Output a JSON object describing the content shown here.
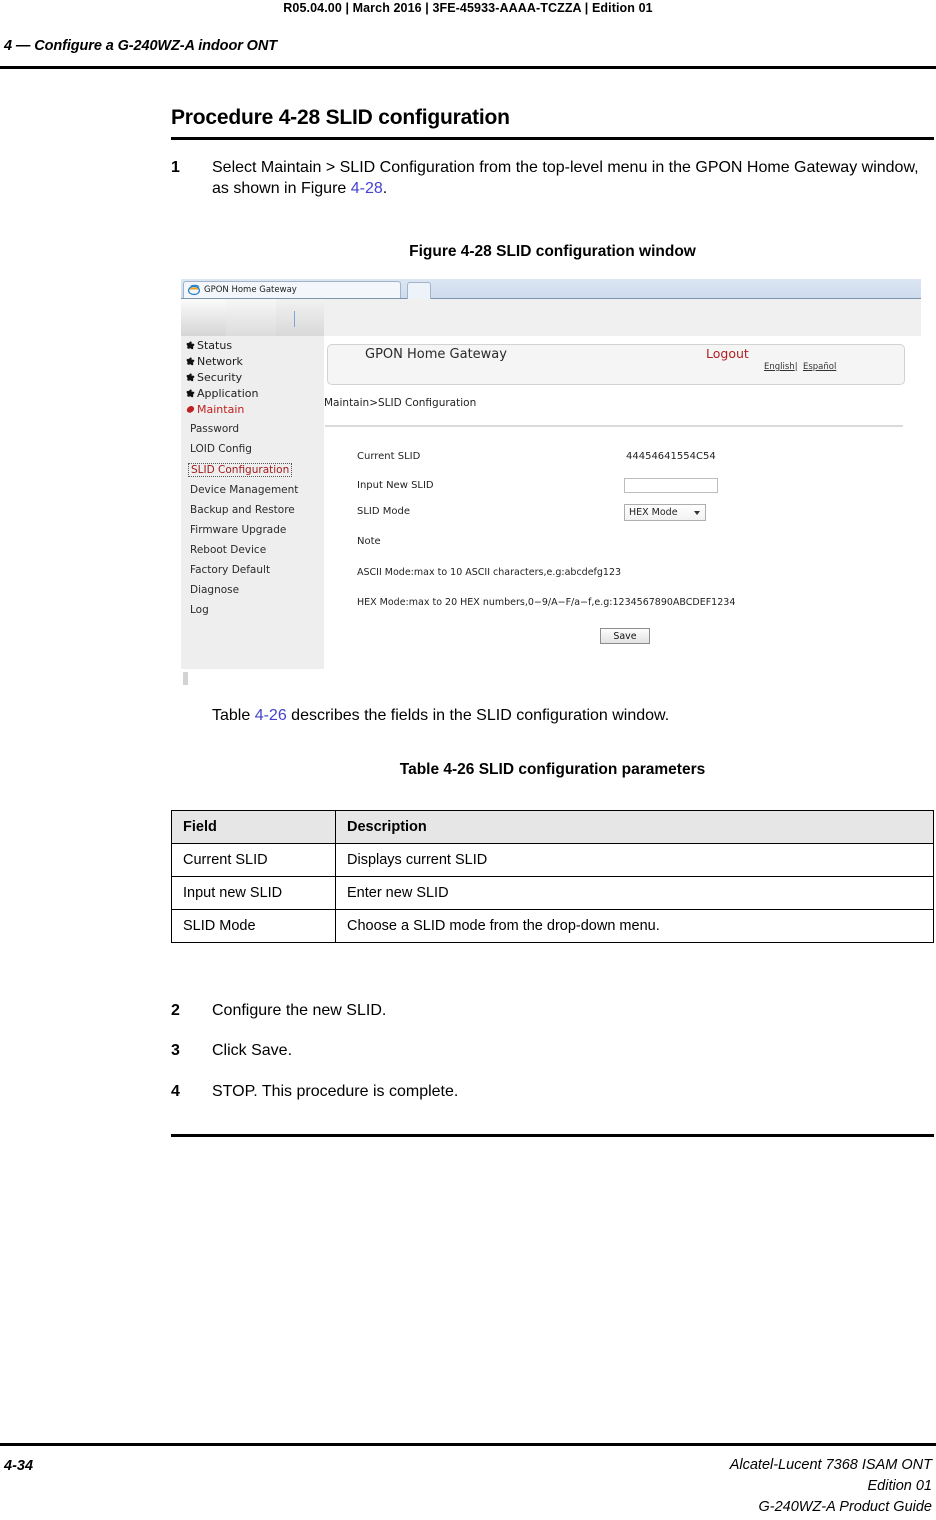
{
  "page": {
    "doc_id_line": "R05.04.00 | March 2016 | 3FE-45933-AAAA-TCZZA | Edition 01",
    "running_head": "4 —  Configure a G-240WZ-A indoor ONT",
    "procedure_heading": "Procedure 4-28  SLID configuration",
    "figure_caption": "Figure 4-28  SLID configuration window",
    "table_caption": "Table 4-26 SLID configuration parameters"
  },
  "steps": [
    {
      "num": "1",
      "text_before": "Select Maintain > SLID Configuration from the top-level menu in the GPON Home Gateway window, as shown in Figure ",
      "xref": "4-28",
      "text_after": "."
    },
    {
      "num": "2",
      "text": "Configure the new SLID."
    },
    {
      "num": "3",
      "text": "Click Save."
    },
    {
      "num": "4",
      "text": "STOP. This procedure is complete."
    }
  ],
  "table_lead": {
    "before": "Table ",
    "xref": "4-26",
    "after": " describes the fields in the SLID configuration window."
  },
  "table": {
    "headers": [
      "Field",
      "Description"
    ],
    "rows": [
      [
        "Current SLID",
        "Displays current SLID"
      ],
      [
        "Input new SLID",
        "Enter new SLID"
      ],
      [
        "SLID Mode",
        "Choose a SLID mode from the drop-down menu."
      ]
    ]
  },
  "screenshot": {
    "browser_tab_title": "GPON Home Gateway",
    "app_title": "GPON Home Gateway",
    "logout_label": "Logout",
    "lang_english": "English",
    "lang_separator": "|",
    "lang_spanish": "Español",
    "breadcrumb": "Maintain>SLID Configuration",
    "nav_groups": [
      {
        "label": "Status"
      },
      {
        "label": "Network"
      },
      {
        "label": "Security"
      },
      {
        "label": "Application"
      },
      {
        "label": "Maintain"
      }
    ],
    "nav_items": [
      {
        "label": "Password"
      },
      {
        "label": "LOID Config"
      },
      {
        "label": "SLID Configuration"
      },
      {
        "label": "Device Management"
      },
      {
        "label": "Backup and Restore"
      },
      {
        "label": "Firmware Upgrade"
      },
      {
        "label": "Reboot Device"
      },
      {
        "label": "Factory Default"
      },
      {
        "label": "Diagnose"
      },
      {
        "label": "Log"
      }
    ],
    "form": {
      "current_slid_label": "Current SLID",
      "current_slid_value": "44454641554C54",
      "input_new_slid_label": "Input New SLID",
      "input_new_slid_value": "",
      "slid_mode_label": "SLID Mode",
      "slid_mode_value": "HEX Mode",
      "note_label": "Note",
      "note_ascii": "ASCII Mode:max to 10 ASCII characters,e.g:abcdefg123",
      "note_hex": "HEX Mode:max to 20 HEX numbers,0−9/A−F/a−f,e.g:1234567890ABCDEF1234",
      "save_label": "Save"
    },
    "colors": {
      "maintain_red": "#c02020",
      "logout_red": "#b02020",
      "selected_nav_red": "#a11b1b"
    }
  },
  "footer": {
    "page_number": "4-34",
    "line1": "Alcatel-Lucent 7368 ISAM ONT",
    "line2": "Edition 01",
    "line3": "G-240WZ-A Product Guide"
  }
}
